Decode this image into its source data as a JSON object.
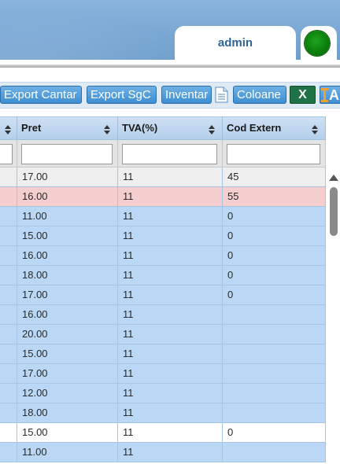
{
  "header": {
    "username": "admin",
    "status_color": "#0b7f0b"
  },
  "toolbar": {
    "export_cantar_label": "Export Cantar",
    "export_sgc_label": "Export SgC",
    "inventar_label": "Inventar",
    "document_icon": "document-icon",
    "coloane_label": "Coloane",
    "excel_label": "X",
    "font_icon": "text-format-icon",
    "font_glyph": "A"
  },
  "table": {
    "columns": [
      "Pret",
      "TVA(%)",
      "Cod Extern"
    ],
    "filters": [
      "",
      "",
      "",
      ""
    ],
    "rows": [
      {
        "pret": "17.00",
        "tva": "11",
        "cod": "45",
        "style": "alt"
      },
      {
        "pret": "16.00",
        "tva": "11",
        "cod": "55",
        "style": "hl"
      },
      {
        "pret": "11.00",
        "tva": "11",
        "cod": "0",
        "style": "sel"
      },
      {
        "pret": "15.00",
        "tva": "11",
        "cod": "0",
        "style": "sel"
      },
      {
        "pret": "16.00",
        "tva": "11",
        "cod": "0",
        "style": "sel"
      },
      {
        "pret": "18.00",
        "tva": "11",
        "cod": "0",
        "style": "sel"
      },
      {
        "pret": "17.00",
        "tva": "11",
        "cod": "0",
        "style": "sel"
      },
      {
        "pret": "16.00",
        "tva": "11",
        "cod": "",
        "style": "sel"
      },
      {
        "pret": "20.00",
        "tva": "11",
        "cod": "",
        "style": "sel"
      },
      {
        "pret": "15.00",
        "tva": "11",
        "cod": "",
        "style": "sel"
      },
      {
        "pret": "17.00",
        "tva": "11",
        "cod": "",
        "style": "sel"
      },
      {
        "pret": "12.00",
        "tva": "11",
        "cod": "",
        "style": "sel"
      },
      {
        "pret": "18.00",
        "tva": "11",
        "cod": "",
        "style": "sel"
      },
      {
        "pret": "15.00",
        "tva": "11",
        "cod": "0",
        "style": "plain"
      },
      {
        "pret": "11.00",
        "tva": "11",
        "cod": "",
        "style": "sel"
      }
    ],
    "row_colors": {
      "alt": "#efefef",
      "hl": "#f5cfcf",
      "sel": "#bad7f5",
      "plain": "#ffffff"
    }
  }
}
